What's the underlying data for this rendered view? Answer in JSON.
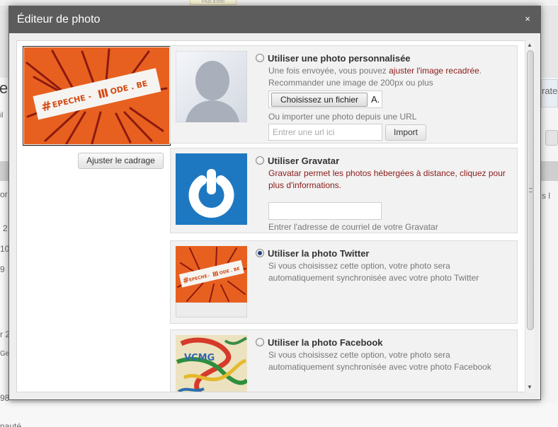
{
  "background": {
    "tooltip": "Plus d'info",
    "left_frags": [
      "e",
      "il",
      "or",
      "2",
      "10",
      "9",
      "r 2",
      "Ge",
      "98"
    ],
    "right_frags": [
      "rate",
      "s l"
    ],
    "bottom_frag": "nauté"
  },
  "dialog": {
    "title": "Éditeur de photo",
    "close_label": "×"
  },
  "preview": {
    "adjust_button": "Ajuster le cadrage"
  },
  "options": {
    "custom": {
      "title": "Utiliser une photo personnalisée",
      "line1_prefix": "Une fois envoyée, vous pouvez ",
      "line1_link": "ajuster l'image recadrée",
      "line1_suffix": ".",
      "line2": "Recommander une image de 200px ou plus",
      "file_button": "Choisissez un fichier",
      "file_status": "A.",
      "url_label": "Ou importer une photo depuis une URL",
      "url_placeholder": "Entrer une url ici",
      "import_button": "Import",
      "checked": false
    },
    "gravatar": {
      "title": "Utiliser Gravatar",
      "line1": "Gravatar permet les photos hébergées à distance, cliquez pour",
      "line2": "plus d'informations.",
      "email_value": "",
      "email_label": "Entrer l'adresse de courriel de votre Gravatar",
      "checked": false
    },
    "twitter": {
      "title": "Utiliser la photo Twitter",
      "line1": "Si vous choisissez cette option, votre photo sera",
      "line2": "automatiquement synchronisée avec votre photo Twitter",
      "checked": true
    },
    "facebook": {
      "title": "Utiliser la photo Facebook",
      "line1": "Si vous choisissez cette option, votre photo sera",
      "line2": "automatiquement synchronisée avec votre photo Facebook",
      "checked": false
    }
  },
  "logo": {
    "text_left": "EPECHE",
    "text_right": "ODE . BE",
    "thumb_text_left": "EPECHE",
    "thumb_text_right": "ODE . BE",
    "facebook_text": "VCMG"
  },
  "colors": {
    "accent_red": "#8b1a1a",
    "logo_orange": "#e8601f",
    "gravatar_blue": "#1e78c1",
    "titlebar": "#5c5c5c"
  },
  "icons": {
    "close": "close-icon",
    "scroll_up": "scroll-up-icon",
    "scroll_down": "scroll-down-icon",
    "avatar_placeholder": "avatar-silhouette-icon",
    "gravatar_logo": "gravatar-logo-icon"
  }
}
